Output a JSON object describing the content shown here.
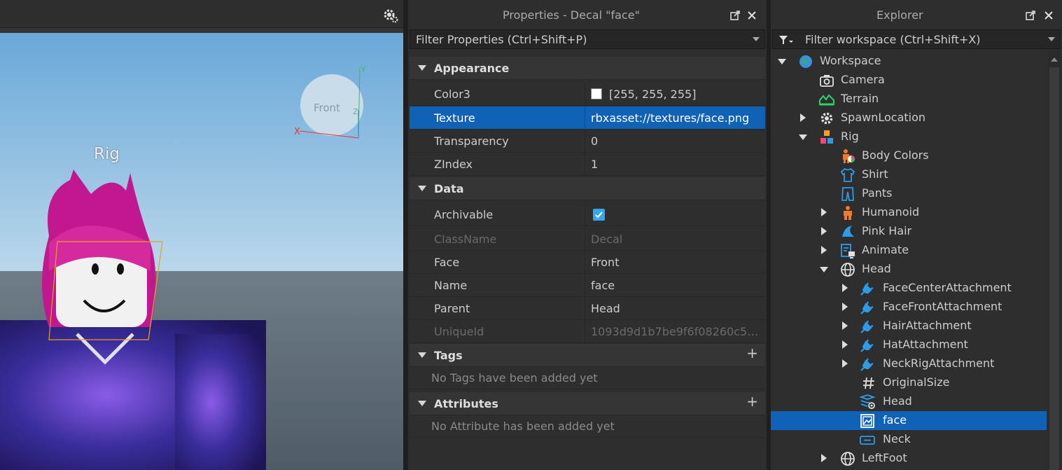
{
  "viewport": {
    "rig_label": "Rig",
    "gizmo_face_label": "Front",
    "axis_x": "X",
    "axis_y": "Y",
    "axis_z": "Z"
  },
  "properties": {
    "title": "Properties - Decal \"face\"",
    "filter_placeholder": "Filter Properties (Ctrl+Shift+P)",
    "sections": {
      "appearance": "Appearance",
      "data": "Data",
      "tags": "Tags",
      "attributes": "Attributes"
    },
    "appearance_rows": [
      {
        "name": "Color3",
        "value": "[255, 255, 255]"
      },
      {
        "name": "Texture",
        "value": "rbxasset://textures/face.png"
      },
      {
        "name": "Transparency",
        "value": "0"
      },
      {
        "name": "ZIndex",
        "value": "1"
      }
    ],
    "data_rows": [
      {
        "name": "Archivable",
        "value": ""
      },
      {
        "name": "ClassName",
        "value": "Decal"
      },
      {
        "name": "Face",
        "value": "Front"
      },
      {
        "name": "Name",
        "value": "face"
      },
      {
        "name": "Parent",
        "value": "Head"
      },
      {
        "name": "UniqueId",
        "value": "1093d9d1b7be9f6f08260c590..."
      }
    ],
    "tags_empty": "No Tags have been added yet",
    "attributes_empty": "No Attribute has been added yet",
    "color3_swatch": "#ffffff",
    "selected_color": "#0f62b5",
    "checkbox_color": "#35a6f0"
  },
  "explorer": {
    "title": "Explorer",
    "filter_placeholder": "Filter workspace (Ctrl+Shift+X)",
    "tree": [
      {
        "label": "Workspace",
        "icon": "globe-icon"
      },
      {
        "label": "Camera",
        "icon": "camera-icon"
      },
      {
        "label": "Terrain",
        "icon": "terrain-icon"
      },
      {
        "label": "SpawnLocation",
        "icon": "gear-icon"
      },
      {
        "label": "Rig",
        "icon": "model-icon"
      },
      {
        "label": "Body Colors",
        "icon": "body-colors-icon"
      },
      {
        "label": "Shirt",
        "icon": "shirt-icon"
      },
      {
        "label": "Pants",
        "icon": "pants-icon"
      },
      {
        "label": "Humanoid",
        "icon": "humanoid-icon"
      },
      {
        "label": "Pink Hair",
        "icon": "accessory-icon"
      },
      {
        "label": "Animate",
        "icon": "script-icon"
      },
      {
        "label": "Head",
        "icon": "part-icon"
      },
      {
        "label": "FaceCenterAttachment",
        "icon": "attachment-icon"
      },
      {
        "label": "FaceFrontAttachment",
        "icon": "attachment-icon"
      },
      {
        "label": "HairAttachment",
        "icon": "attachment-icon"
      },
      {
        "label": "HatAttachment",
        "icon": "attachment-icon"
      },
      {
        "label": "NeckRigAttachment",
        "icon": "attachment-icon"
      },
      {
        "label": "OriginalSize",
        "icon": "value-icon"
      },
      {
        "label": "Head",
        "icon": "special-mesh-icon"
      },
      {
        "label": "face",
        "icon": "decal-icon"
      },
      {
        "label": "Neck",
        "icon": "motor-icon"
      },
      {
        "label": "LeftFoot",
        "icon": "part-icon"
      }
    ]
  }
}
